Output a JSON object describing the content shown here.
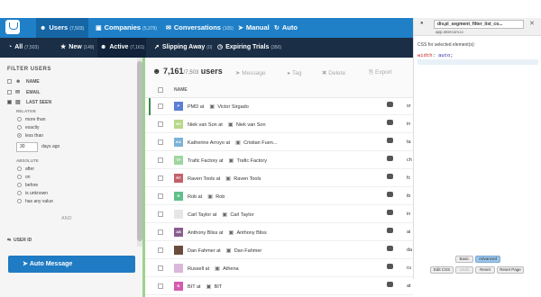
{
  "nav": {
    "tabs": [
      {
        "label": "Users",
        "count": "(7,503)",
        "icon": "users-icon",
        "active": true
      },
      {
        "label": "Companies",
        "count": "(5,379)",
        "icon": "briefcase-icon"
      },
      {
        "label": "Conversations",
        "count": "(105)",
        "icon": "chat-icon"
      },
      {
        "label": "Manual",
        "icon": "send-icon"
      },
      {
        "label": "Auto",
        "icon": "auto-icon"
      }
    ]
  },
  "subnav": {
    "tabs": [
      {
        "label": "All",
        "count": "(7,503)",
        "icon": "pie-icon"
      },
      {
        "label": "New",
        "count": "(149)",
        "icon": "star-icon"
      },
      {
        "label": "Active",
        "count": "(7,161)",
        "icon": "user-icon",
        "active": true
      },
      {
        "label": "Slipping Away",
        "count": "(0)",
        "icon": "arrow-icon"
      },
      {
        "label": "Expiring Trials",
        "count": "(350)",
        "icon": "clock-icon"
      }
    ]
  },
  "filters": {
    "title": "FILTER USERS",
    "name_label": "NAME",
    "email_label": "EMAIL",
    "last_seen_label": "LAST SEEN",
    "relative_label": "RELATIVE",
    "radios": [
      "more than",
      "exactly",
      "less than"
    ],
    "days_value": "30",
    "days_suffix": "days ago",
    "absolute_label": "ABSOLUTE",
    "absolute_radios": [
      "after",
      "on",
      "before",
      "is unknown",
      "has any value"
    ],
    "and_label": "AND",
    "user_id_label": "USER ID",
    "auto_message_button": "Auto Message"
  },
  "toolbar": {
    "count": "7,161",
    "total": "/7,503",
    "count_suffix": "users",
    "message": "Message",
    "tag": "Tag",
    "delete": "Delete",
    "export": "Export"
  },
  "table": {
    "header": "NAME",
    "rows": [
      {
        "avatar": "P",
        "color": "#5b7fd6",
        "name": "PMD at",
        "company": "Victor Sirgado",
        "extra": "sr"
      },
      {
        "avatar": "NV",
        "color": "#b8d88a",
        "name": "Niek van Son at",
        "company": "Niek van Son",
        "extra": "in"
      },
      {
        "avatar": "KA",
        "color": "#7bb2d6",
        "name": "Katherine Arroyo at",
        "company": "Cristian Fuen...",
        "extra": "ta"
      },
      {
        "avatar": "TF",
        "color": "#9fd69f",
        "name": "Trafic Factory at",
        "company": "Trafic Factory",
        "extra": "ch"
      },
      {
        "avatar": "RT",
        "color": "#c4606a",
        "name": "Raven Tools at",
        "company": "Raven Tools",
        "extra": "fc"
      },
      {
        "avatar": "R",
        "color": "#5fc08a",
        "name": "Rob at",
        "company": "Rob",
        "extra": "ib"
      },
      {
        "avatar": "",
        "color": "#e6e6e6",
        "name": "Carl Taylor at",
        "company": "Carl Taylor",
        "extra": "in"
      },
      {
        "avatar": "AB",
        "color": "#8a5c8f",
        "name": "Anthony Bliss at",
        "company": "Anthony Bliss",
        "extra": "ai"
      },
      {
        "avatar": "",
        "color": "#6b4b3b",
        "name": "Dan Fahmer at",
        "company": "Dan Fahmer",
        "extra": "da"
      },
      {
        "avatar": "",
        "color": "#d9b8d9",
        "name": "Russell at",
        "company": "Athena",
        "extra": "ru"
      },
      {
        "avatar": "B",
        "color": "#d65bb0",
        "name": "BIT at",
        "company": "BIT",
        "extra": "at"
      }
    ]
  },
  "devtools": {
    "selector": "div.pl_segment_filter_list_co...",
    "url": "app.intercom.io",
    "css_label": "CSS for selected element(s):",
    "css_prop": "width",
    "css_value": "auto",
    "basic": "Basic",
    "advanced": "Advanced",
    "edit_css": "Edit CSS",
    "undo": "Undo",
    "reset": "Reset",
    "reset_page": "Reset Page"
  }
}
